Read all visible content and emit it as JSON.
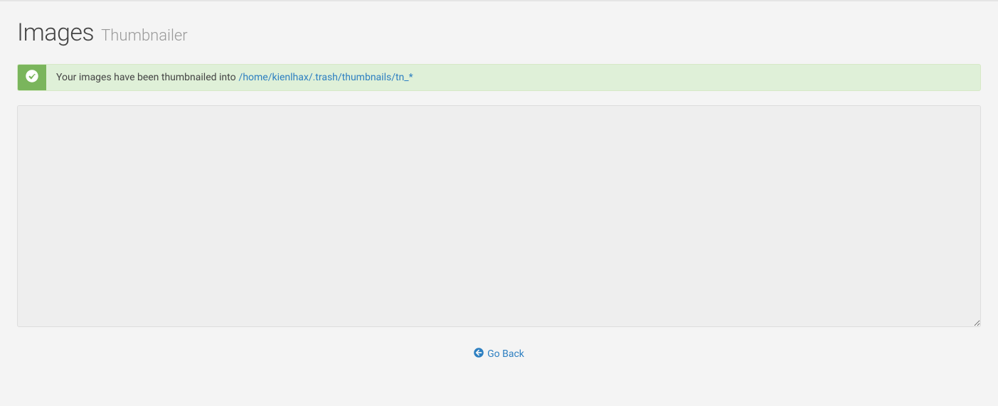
{
  "header": {
    "title": "Images",
    "subtitle": "Thumbnailer"
  },
  "alert": {
    "message": "Your images have been thumbnailed into",
    "link_text": "/home/kienlhax/.trash/thumbnails/tn_*"
  },
  "output": {
    "value": ""
  },
  "footer": {
    "go_back_label": "Go Back"
  }
}
